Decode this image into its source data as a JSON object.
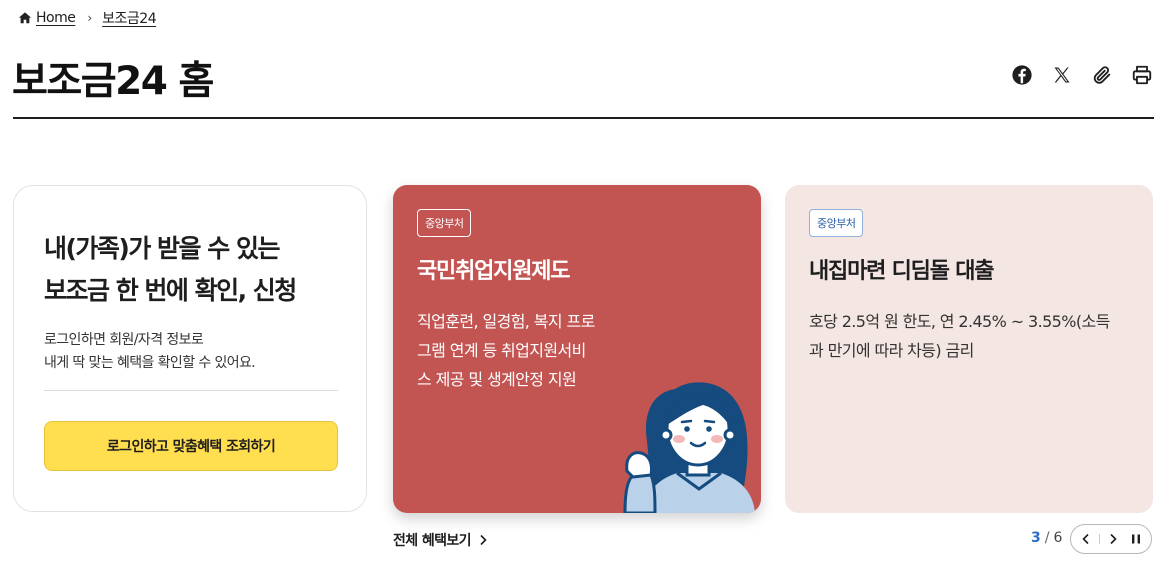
{
  "breadcrumb": {
    "home": "Home",
    "current": "보조금24"
  },
  "page": {
    "title": "보조금24 홈"
  },
  "share": {
    "icons": [
      "facebook-icon",
      "x-icon",
      "paperclip-icon",
      "print-icon"
    ]
  },
  "login_card": {
    "headline_line1": "내(가족)가 받을 수 있는",
    "headline_line2": "보조금 한 번에 확인, 신청",
    "desc_line1": "로그인하면 회원/자격 정보로",
    "desc_line2": "내게 딱 맞는 혜택을 확인할 수 있어요.",
    "button_label": "로그인하고 맞춤혜택 조회하기"
  },
  "cards": [
    {
      "badge": "중앙부처",
      "title": "국민취업지원제도",
      "desc_lines": [
        "직업훈련, 일경험, 복지 프로",
        "그램 연계 등 취업지원서비",
        "스 제공 및 생계안정 지원"
      ],
      "color": "#c25452"
    },
    {
      "badge": "중앙부처",
      "title": "내집마련 디딤돌 대출",
      "desc_lines": [
        "호당 2.5억 원 한도, 연 2.45% ~ 3.55%(소득",
        "과 만기에 따라 차등) 금리"
      ],
      "color": "#f4e6e3"
    }
  ],
  "view_all": {
    "label": "전체 혜택보기"
  },
  "pager": {
    "current": "3",
    "total": "6"
  },
  "colors": {
    "accent": "#ffde4f",
    "pager_current": "#2c6fc7"
  }
}
